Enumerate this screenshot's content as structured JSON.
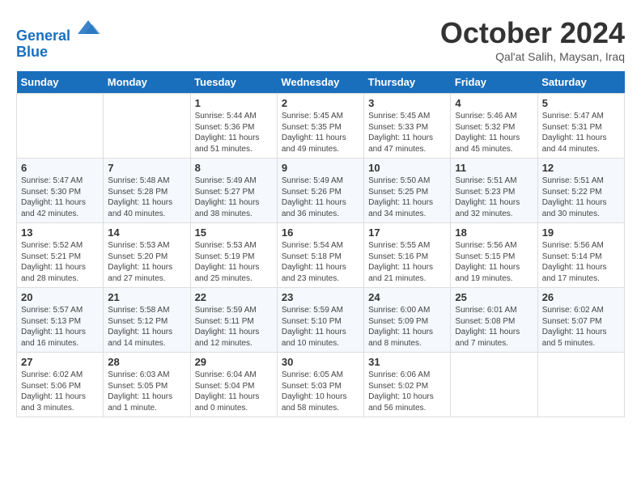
{
  "header": {
    "logo_line1": "General",
    "logo_line2": "Blue",
    "month": "October 2024",
    "location": "Qal'at Salih, Maysan, Iraq"
  },
  "weekdays": [
    "Sunday",
    "Monday",
    "Tuesday",
    "Wednesday",
    "Thursday",
    "Friday",
    "Saturday"
  ],
  "weeks": [
    [
      {
        "day": "",
        "info": ""
      },
      {
        "day": "",
        "info": ""
      },
      {
        "day": "1",
        "info": "Sunrise: 5:44 AM\nSunset: 5:36 PM\nDaylight: 11 hours and 51 minutes."
      },
      {
        "day": "2",
        "info": "Sunrise: 5:45 AM\nSunset: 5:35 PM\nDaylight: 11 hours and 49 minutes."
      },
      {
        "day": "3",
        "info": "Sunrise: 5:45 AM\nSunset: 5:33 PM\nDaylight: 11 hours and 47 minutes."
      },
      {
        "day": "4",
        "info": "Sunrise: 5:46 AM\nSunset: 5:32 PM\nDaylight: 11 hours and 45 minutes."
      },
      {
        "day": "5",
        "info": "Sunrise: 5:47 AM\nSunset: 5:31 PM\nDaylight: 11 hours and 44 minutes."
      }
    ],
    [
      {
        "day": "6",
        "info": "Sunrise: 5:47 AM\nSunset: 5:30 PM\nDaylight: 11 hours and 42 minutes."
      },
      {
        "day": "7",
        "info": "Sunrise: 5:48 AM\nSunset: 5:28 PM\nDaylight: 11 hours and 40 minutes."
      },
      {
        "day": "8",
        "info": "Sunrise: 5:49 AM\nSunset: 5:27 PM\nDaylight: 11 hours and 38 minutes."
      },
      {
        "day": "9",
        "info": "Sunrise: 5:49 AM\nSunset: 5:26 PM\nDaylight: 11 hours and 36 minutes."
      },
      {
        "day": "10",
        "info": "Sunrise: 5:50 AM\nSunset: 5:25 PM\nDaylight: 11 hours and 34 minutes."
      },
      {
        "day": "11",
        "info": "Sunrise: 5:51 AM\nSunset: 5:23 PM\nDaylight: 11 hours and 32 minutes."
      },
      {
        "day": "12",
        "info": "Sunrise: 5:51 AM\nSunset: 5:22 PM\nDaylight: 11 hours and 30 minutes."
      }
    ],
    [
      {
        "day": "13",
        "info": "Sunrise: 5:52 AM\nSunset: 5:21 PM\nDaylight: 11 hours and 28 minutes."
      },
      {
        "day": "14",
        "info": "Sunrise: 5:53 AM\nSunset: 5:20 PM\nDaylight: 11 hours and 27 minutes."
      },
      {
        "day": "15",
        "info": "Sunrise: 5:53 AM\nSunset: 5:19 PM\nDaylight: 11 hours and 25 minutes."
      },
      {
        "day": "16",
        "info": "Sunrise: 5:54 AM\nSunset: 5:18 PM\nDaylight: 11 hours and 23 minutes."
      },
      {
        "day": "17",
        "info": "Sunrise: 5:55 AM\nSunset: 5:16 PM\nDaylight: 11 hours and 21 minutes."
      },
      {
        "day": "18",
        "info": "Sunrise: 5:56 AM\nSunset: 5:15 PM\nDaylight: 11 hours and 19 minutes."
      },
      {
        "day": "19",
        "info": "Sunrise: 5:56 AM\nSunset: 5:14 PM\nDaylight: 11 hours and 17 minutes."
      }
    ],
    [
      {
        "day": "20",
        "info": "Sunrise: 5:57 AM\nSunset: 5:13 PM\nDaylight: 11 hours and 16 minutes."
      },
      {
        "day": "21",
        "info": "Sunrise: 5:58 AM\nSunset: 5:12 PM\nDaylight: 11 hours and 14 minutes."
      },
      {
        "day": "22",
        "info": "Sunrise: 5:59 AM\nSunset: 5:11 PM\nDaylight: 11 hours and 12 minutes."
      },
      {
        "day": "23",
        "info": "Sunrise: 5:59 AM\nSunset: 5:10 PM\nDaylight: 11 hours and 10 minutes."
      },
      {
        "day": "24",
        "info": "Sunrise: 6:00 AM\nSunset: 5:09 PM\nDaylight: 11 hours and 8 minutes."
      },
      {
        "day": "25",
        "info": "Sunrise: 6:01 AM\nSunset: 5:08 PM\nDaylight: 11 hours and 7 minutes."
      },
      {
        "day": "26",
        "info": "Sunrise: 6:02 AM\nSunset: 5:07 PM\nDaylight: 11 hours and 5 minutes."
      }
    ],
    [
      {
        "day": "27",
        "info": "Sunrise: 6:02 AM\nSunset: 5:06 PM\nDaylight: 11 hours and 3 minutes."
      },
      {
        "day": "28",
        "info": "Sunrise: 6:03 AM\nSunset: 5:05 PM\nDaylight: 11 hours and 1 minute."
      },
      {
        "day": "29",
        "info": "Sunrise: 6:04 AM\nSunset: 5:04 PM\nDaylight: 11 hours and 0 minutes."
      },
      {
        "day": "30",
        "info": "Sunrise: 6:05 AM\nSunset: 5:03 PM\nDaylight: 10 hours and 58 minutes."
      },
      {
        "day": "31",
        "info": "Sunrise: 6:06 AM\nSunset: 5:02 PM\nDaylight: 10 hours and 56 minutes."
      },
      {
        "day": "",
        "info": ""
      },
      {
        "day": "",
        "info": ""
      }
    ]
  ]
}
